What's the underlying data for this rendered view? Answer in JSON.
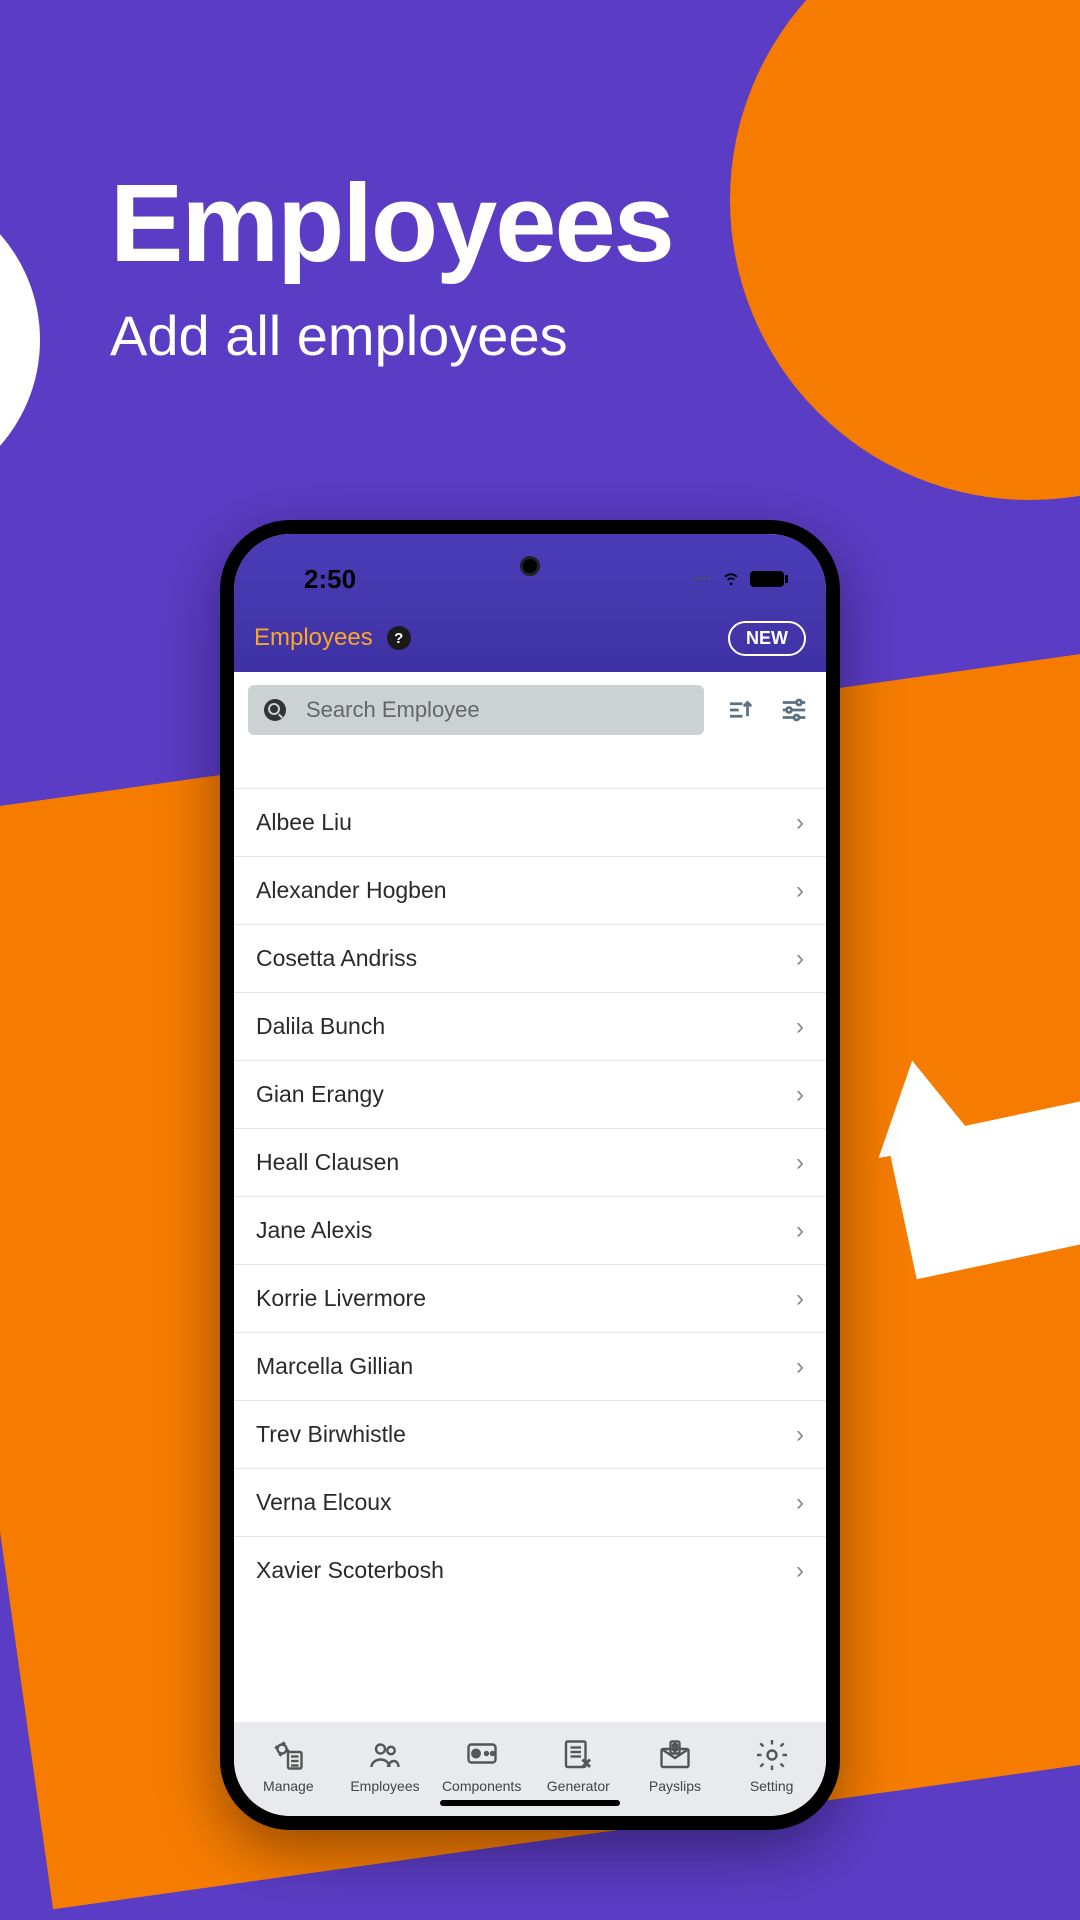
{
  "marketing": {
    "title": "Employees",
    "subtitle": "Add all employees"
  },
  "status": {
    "time": "2:50"
  },
  "header": {
    "title": "Employees",
    "help_label": "?",
    "new_label": "NEW"
  },
  "search": {
    "placeholder": "Search Employee"
  },
  "employees": [
    {
      "name": "Albee Liu"
    },
    {
      "name": "Alexander Hogben"
    },
    {
      "name": "Cosetta Andriss"
    },
    {
      "name": "Dalila Bunch"
    },
    {
      "name": "Gian Erangy"
    },
    {
      "name": "Heall Clausen"
    },
    {
      "name": "Jane Alexis"
    },
    {
      "name": "Korrie Livermore"
    },
    {
      "name": "Marcella Gillian"
    },
    {
      "name": "Trev Birwhistle"
    },
    {
      "name": "Verna Elcoux"
    },
    {
      "name": "Xavier Scoterbosh"
    }
  ],
  "nav": {
    "items": [
      {
        "label": "Manage"
      },
      {
        "label": "Employees"
      },
      {
        "label": "Components"
      },
      {
        "label": "Generator"
      },
      {
        "label": "Payslips"
      },
      {
        "label": "Setting"
      }
    ]
  }
}
